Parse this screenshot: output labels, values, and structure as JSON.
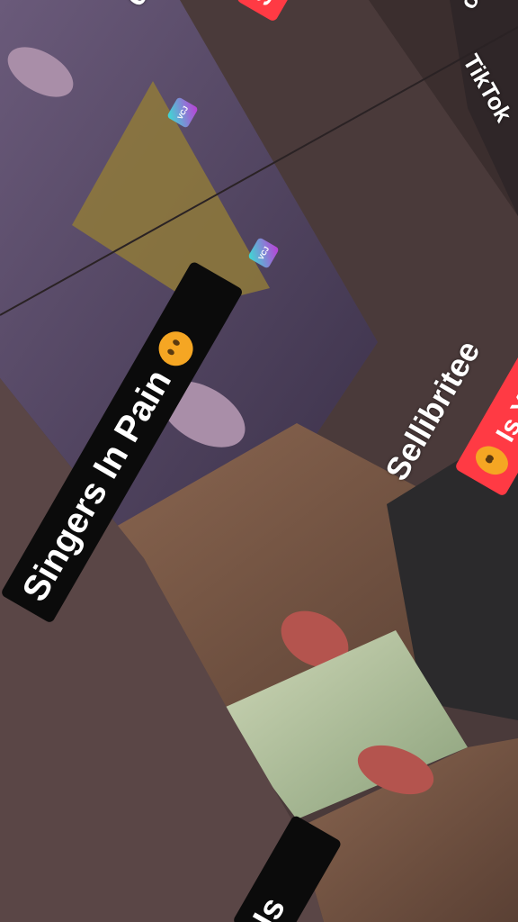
{
  "labels": {
    "top_left_partial": "ee",
    "top_red_partial": "Seriti",
    "top_right_partial": "ok",
    "tiktok_partial": "TikTok",
    "singers_title": "Singers In Pain",
    "sellibritee": "Sellibritee",
    "question": "Is Your Most Favourite?",
    "bottom_partial": "Is"
  },
  "icons": {
    "pain_emoji": "emoji-icon",
    "question_emoji": "emoji-icon",
    "watermark_logo": "logo-icon"
  },
  "colors": {
    "background": "#4a3a3a",
    "caption_black": "#0b0b0b",
    "caption_red": "#ff3a44",
    "text": "#ffffff"
  }
}
